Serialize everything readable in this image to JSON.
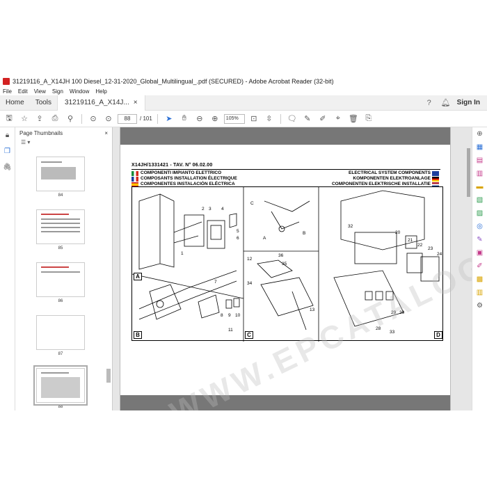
{
  "window": {
    "title": "31219116_A_X14JH 100 Diesel_12-31-2020_Global_Multilingual_.pdf (SECURED) - Adobe Acrobat Reader (32-bit)"
  },
  "menu": [
    "File",
    "Edit",
    "View",
    "Sign",
    "Window",
    "Help"
  ],
  "tabs": {
    "home": "Home",
    "tools": "Tools",
    "document": "31219116_A_X14J...",
    "close": "×",
    "sign_in": "Sign In"
  },
  "toolbar": {
    "page_current": "88",
    "page_total": "/ 101",
    "zoom": "105%"
  },
  "thumbnails": {
    "title": "Page Thumbnails",
    "close": "×",
    "options_icon": "list-options-icon",
    "pages": [
      "84",
      "85",
      "86",
      "87",
      "88"
    ],
    "selected": "88"
  },
  "document": {
    "header_id": "X14JH/1331421 - TAV. N° 06.02.00",
    "titles_left": [
      "COMPONENTI IMPIANTO ELETTRICO",
      "COMPOSANTS INSTALLATION ÉLECTRIQUE",
      "COMPONENTES INSTALACIÓN ELÉCTRICA"
    ],
    "titles_right": [
      "ELECTRICAL SYSTEM COMPONENTS",
      "KOMPONENTEN ELEKTROANLAGE",
      "COMPONENTEN ELEKTRISCHE INSTALLATIE"
    ],
    "panels": [
      "A",
      "B",
      "C",
      "D"
    ],
    "callouts_a": [
      "2",
      "3",
      "1",
      "4",
      "5",
      "6"
    ],
    "callouts_b": [
      "7",
      "8",
      "9",
      "10",
      "11"
    ],
    "callouts_c": [
      "12",
      "34",
      "35",
      "36",
      "13"
    ],
    "callouts_c_top": [
      "A",
      "B",
      "C"
    ],
    "callouts_d": [
      "32",
      "20",
      "21",
      "22",
      "23",
      "24",
      "28",
      "29",
      "30",
      "33"
    ],
    "watermark": "WWW.EPCATALOGS.COM"
  },
  "colors": {
    "acrobat_red": "#d32222",
    "accent_blue": "#2a6fd6",
    "doc_gray": "#777777"
  }
}
